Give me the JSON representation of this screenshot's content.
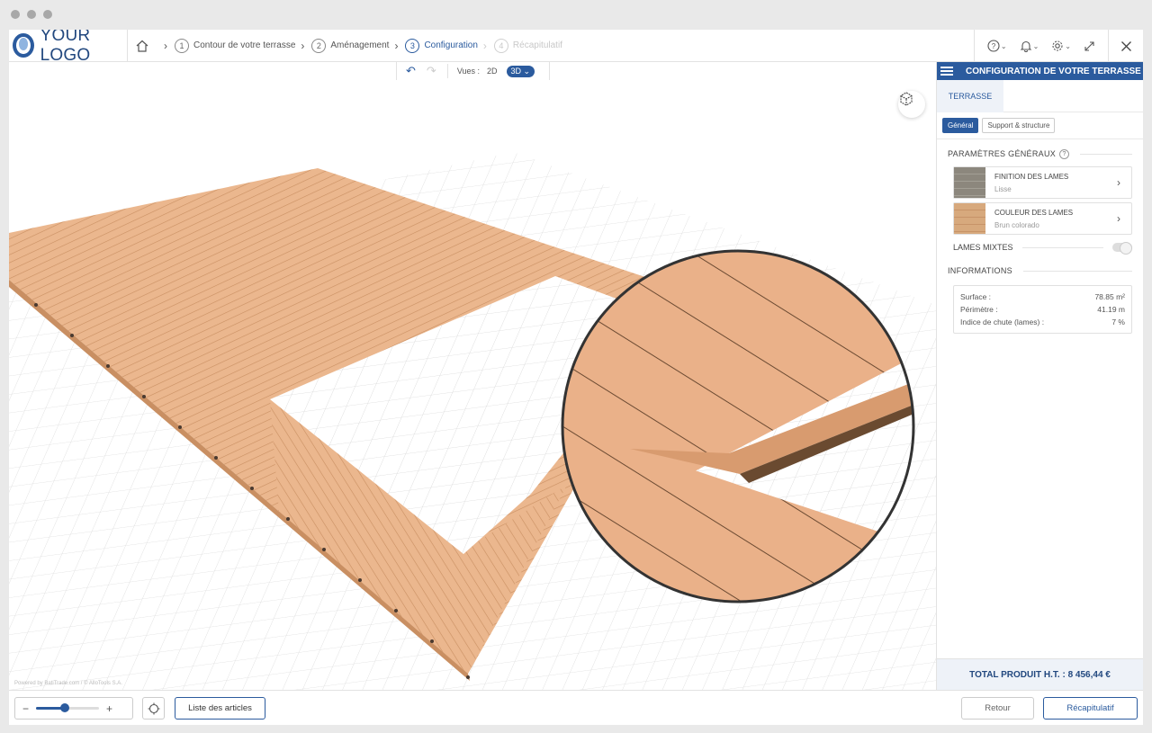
{
  "logo": {
    "text": "YOUR LOGO"
  },
  "steps": [
    {
      "num": "1",
      "label": "Contour de votre terrasse",
      "state": "done"
    },
    {
      "num": "2",
      "label": "Aménagement",
      "state": "done"
    },
    {
      "num": "3",
      "label": "Configuration",
      "state": "active"
    },
    {
      "num": "4",
      "label": "Récapitulatif",
      "state": "disabled"
    }
  ],
  "header_tools": {
    "help_icon": "help-icon",
    "bell_icon": "bell-icon",
    "settings_icon": "gear-icon",
    "expand_icon": "expand-icon",
    "close_icon": "close-icon"
  },
  "toolbar": {
    "views_label": "Vues :",
    "view_2d": "2D",
    "view_3d": "3D"
  },
  "viewport": {
    "powered_by": "Powered by BatiTrade.com / © AlloTools S.A."
  },
  "panel": {
    "title": "CONFIGURATION DE VOTRE TERRASSE",
    "tab": "TERRASSE",
    "subtabs": [
      "Général",
      "Support & structure"
    ],
    "general_section": "PARAMÈTRES GÉNÉRAUX",
    "params": [
      {
        "title": "FINITION DES LAMES",
        "value": "Lisse"
      },
      {
        "title": "COULEUR DES LAMES",
        "value": "Brun colorado"
      }
    ],
    "mixed_label": "LAMES MIXTES",
    "mixed_on": false,
    "info_section": "INFORMATIONS",
    "info": [
      {
        "label": "Surface :",
        "value": "78.85 m²"
      },
      {
        "label": "Périmètre :",
        "value": "41.19 m"
      },
      {
        "label": "Indice de chute (lames) :",
        "value": "7 %"
      }
    ],
    "total": "TOTAL PRODUIT H.T. : 8 456,44 €"
  },
  "bottom": {
    "zoom_minus": "−",
    "zoom_plus": "+",
    "zoom_level": 0.45,
    "articles_button": "Liste des articles",
    "back_button": "Retour",
    "summary_button": "Récapitulatif"
  },
  "colors": {
    "brand": "#2b5b9e",
    "deck": "#e8b48a",
    "deck_dark": "#c98f62"
  }
}
